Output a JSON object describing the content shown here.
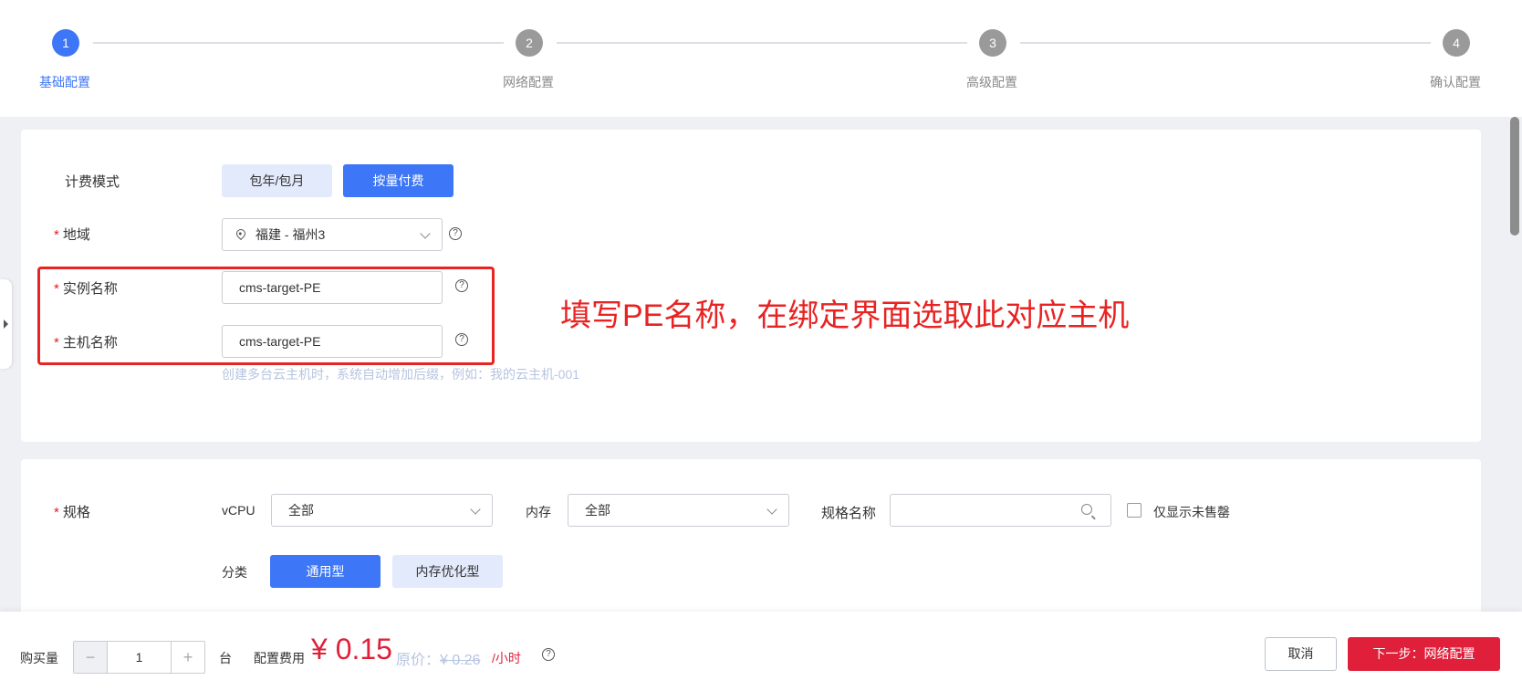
{
  "steps": [
    {
      "num": "1",
      "label": "基础配置"
    },
    {
      "num": "2",
      "label": "网络配置"
    },
    {
      "num": "3",
      "label": "高级配置"
    },
    {
      "num": "4",
      "label": "确认配置"
    }
  ],
  "billing": {
    "label": "计费模式",
    "options": [
      "包年/包月",
      "按量付费"
    ],
    "selected": "按量付费"
  },
  "region": {
    "label": "地域",
    "value": "福建 - 福州3"
  },
  "instance_name": {
    "label": "实例名称",
    "value": "cms-target-PE"
  },
  "host_name": {
    "label": "主机名称",
    "value": "cms-target-PE"
  },
  "host_hint": "创建多台云主机时，系统自动增加后缀，例如：我的云主机-001",
  "annotation": "填写PE名称，在绑定界面选取此对应主机",
  "spec": {
    "label": "规格",
    "vcpu_label": "vCPU",
    "vcpu_value": "全部",
    "mem_label": "内存",
    "mem_value": "全部",
    "name_label": "规格名称",
    "name_placeholder": "",
    "only_available_label": "仅显示未售罄",
    "category_label": "分类",
    "categories": [
      "通用型",
      "内存优化型"
    ],
    "category_selected": "通用型"
  },
  "footer": {
    "qty_label": "购买量",
    "qty_value": "1",
    "qty_unit": "台",
    "fee_label": "配置费用",
    "price": "¥ 0.15",
    "orig_label": "原价：",
    "orig_price": "¥ 0.26",
    "per_hour": "/小时",
    "cancel_label": "取消",
    "next_label": "下一步：网络配置"
  },
  "colors": {
    "primary": "#3d76f6",
    "danger": "#e0203b",
    "annotation": "#e82323"
  }
}
